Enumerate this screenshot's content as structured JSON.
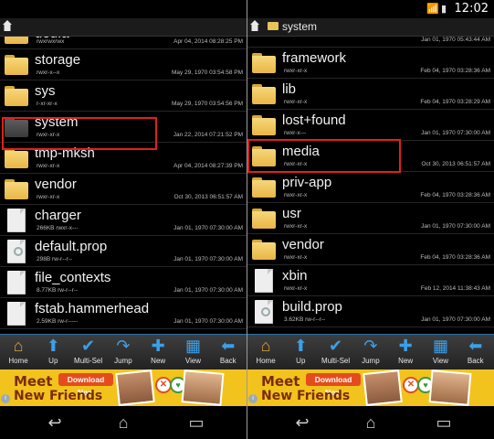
{
  "status_bar": {
    "time": "12:02"
  },
  "left": {
    "path": "",
    "partial_name": "ueu.a",
    "rows": [
      {
        "name": "",
        "perm": "rwxrwxrwx",
        "date": "Apr 04, 2014 08:28:25 PM",
        "icon": "folder-icon"
      },
      {
        "name": "storage",
        "perm": "rwxr-x--x",
        "date": "May 29, 1970 03:54:58 PM",
        "icon": "folder-icon"
      },
      {
        "name": "sys",
        "perm": "r-xr-xr-x",
        "date": "May 29, 1970 03:54:56 PM",
        "icon": "folder-icon"
      },
      {
        "name": "system",
        "perm": "rwxr-xr-x",
        "date": "Jan 22, 2014 07:21:52 PM",
        "icon": "folder-dark-icon"
      },
      {
        "name": "tmp-mksh",
        "perm": "rwxr-xr-x",
        "date": "Apr 04, 2014 08:27:39 PM",
        "icon": "folder-icon"
      },
      {
        "name": "vendor",
        "perm": "rwxr-xr-x",
        "date": "Oct 30, 2013 06:51:57 AM",
        "icon": "folder-icon"
      },
      {
        "name": "charger",
        "perm": "266KB rwxr-x---",
        "date": "Jan 01, 1970 07:30:00 AM",
        "icon": "file-icon"
      },
      {
        "name": "default.prop",
        "perm": "298B rw-r--r--",
        "date": "Jan 01, 1970 07:30:00 AM",
        "icon": "settings-file-icon"
      },
      {
        "name": "file_contexts",
        "perm": "8.77KB rw-r--r--",
        "date": "Jan 01, 1970 07:30:00 AM",
        "icon": "file-icon"
      },
      {
        "name": "fstab.hammerhead",
        "perm": "2.59KB rw-r-----",
        "date": "Jan 01, 1970 07:30:00 AM",
        "icon": "file-icon"
      }
    ]
  },
  "right": {
    "path": "system",
    "rows": [
      {
        "name": "",
        "perm": "",
        "date": "Jan 01, 1970 05:43:44 AM",
        "icon": "none"
      },
      {
        "name": "framework",
        "perm": "rwxr-xr-x",
        "date": "Feb 04, 1970 03:28:36 AM",
        "icon": "folder-icon"
      },
      {
        "name": "lib",
        "perm": "rwxr-xr-x",
        "date": "Feb 04, 1970 03:28:29 AM",
        "icon": "folder-icon"
      },
      {
        "name": "lost+found",
        "perm": "rwxr-x---",
        "date": "Jan 01, 1970 07:30:00 AM",
        "icon": "folder-icon"
      },
      {
        "name": "media",
        "perm": "rwxr-xr-x",
        "date": "Oct 30, 2013 06:51:57 AM",
        "icon": "folder-icon"
      },
      {
        "name": "priv-app",
        "perm": "rwxr-xr-x",
        "date": "Feb 04, 1970 03:28:36 AM",
        "icon": "folder-icon"
      },
      {
        "name": "usr",
        "perm": "rwxr-xr-x",
        "date": "Jan 01, 1970 07:30:00 AM",
        "icon": "folder-icon"
      },
      {
        "name": "vendor",
        "perm": "rwxr-xr-x",
        "date": "Feb 04, 1970 03:28:36 AM",
        "icon": "folder-icon"
      },
      {
        "name": "xbin",
        "perm": "rwxr-xr-x",
        "date": "Feb 12, 2014 11:38:43 AM",
        "icon": "file-icon"
      },
      {
        "name": "build.prop",
        "perm": "3.62KB rw-r--r--",
        "date": "Jan 01, 1970 07:30:00 AM",
        "icon": "settings-file-icon"
      }
    ]
  },
  "toolbar": [
    {
      "label": "Home",
      "icon": "home-icon",
      "glyph": "⌂"
    },
    {
      "label": "Up",
      "icon": "arrow-up-icon",
      "glyph": "⬆"
    },
    {
      "label": "Multi-Sel",
      "icon": "checkmark-icon",
      "glyph": "✔"
    },
    {
      "label": "Jump",
      "icon": "jump-arrow-icon",
      "glyph": "↷"
    },
    {
      "label": "New",
      "icon": "plus-icon",
      "glyph": "✚"
    },
    {
      "label": "View",
      "icon": "grid-view-icon",
      "glyph": "▦"
    },
    {
      "label": "Back",
      "icon": "arrow-left-icon",
      "glyph": "⬅"
    }
  ],
  "ad": {
    "line1": "Meet",
    "line2": "New Friends",
    "button": "Download Now"
  },
  "navbar": [
    {
      "icon": "back-icon",
      "glyph": "↩"
    },
    {
      "icon": "home-icon",
      "glyph": "⌂"
    },
    {
      "icon": "recents-icon",
      "glyph": "▭"
    }
  ],
  "colors": {
    "highlight": "#e02020",
    "folder": "#f0c55a",
    "toolbar_accent": "#3aa0e8"
  }
}
